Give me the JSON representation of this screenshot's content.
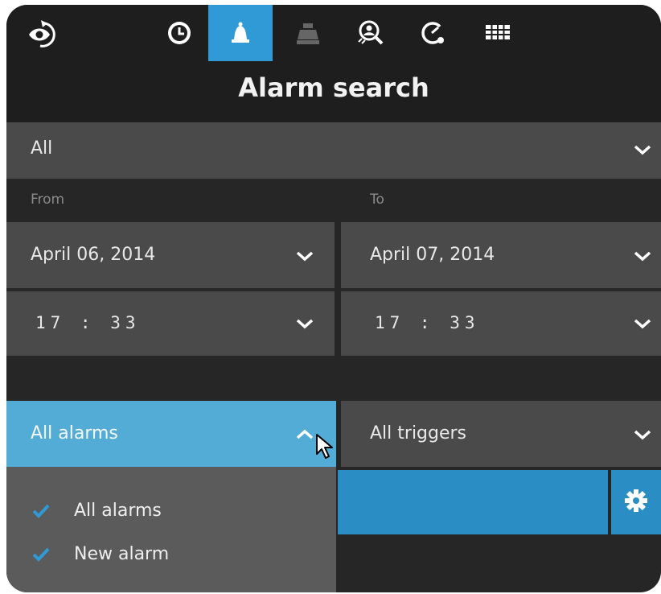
{
  "colors": {
    "accent": "#2f9ad6",
    "accent_light": "#53acd6",
    "dark": "#1e1e1e",
    "field": "#4a4a4a"
  },
  "topbar": {
    "icons": [
      "back-eye-icon",
      "clock-icon",
      "bell-icon",
      "cash-register-icon",
      "search-person-icon",
      "gauge-icon",
      "grid-icon"
    ],
    "active": "bell-icon"
  },
  "title": "Alarm search",
  "camera_select": {
    "value": "All"
  },
  "range": {
    "from_label": "From",
    "to_label": "To",
    "from_date": "April 06, 2014",
    "to_date": "April 07, 2014",
    "from_time": "17 : 33",
    "to_time": "17 : 33"
  },
  "alarm_filter": {
    "value": "All alarms",
    "expanded": true
  },
  "trigger_filter": {
    "value": "All triggers"
  },
  "alarm_menu": {
    "items": [
      {
        "label": "All alarms",
        "checked": true
      },
      {
        "label": "New alarm",
        "checked": true
      }
    ]
  }
}
